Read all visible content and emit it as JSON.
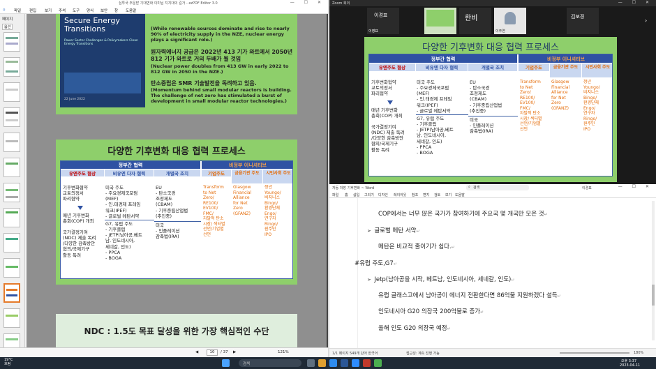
{
  "pdf_window": {
    "title": "심투국 주문받 기대변화 이미님 지지대의 길거 - ezPDF Editor 3.0",
    "menu": [
      "파일",
      "편집",
      "보기",
      "주석",
      "도구",
      "양식",
      "보안",
      "창",
      "도움말"
    ],
    "side_label": "페이지",
    "side_btn": "옵션",
    "page_current": "10",
    "page_total": "/ 37",
    "zoom": "121%",
    "top_slide": {
      "cover_title": "Secure Energy Transitions",
      "cover_sub": "Power Sector Challenges & Policymakers Clean Energy Transitions",
      "cover_date": "22 June 2022",
      "p1": "(While renewable sources dominate and rise to nearly 90% of electricity supply in the NZE, nuclear energy plays a significant role.)",
      "p2_kr": "원자력에너지 공급은 2022년 413 기가 와트에서 2050년 812 기가 와트로 거의 두배가 될 것임",
      "p2_en": "(Nuclear power doubles from 413 GW in early 2022 to 812 GW in 2050 in the NZE.)",
      "p3_kr": "탄소중립은 SMR 기술발전을 독려하고 있음.",
      "p3_en": "(Momentum behind small modular reactors is building. The challenge of net zero has stimulated a burst of development in small modular reactor technologies.)"
    },
    "bottom_slide_title": "NDC : 1.5도 목표 달성을 위한 가장 핵심적인 수단"
  },
  "cooperation_slide": {
    "title": "다양한 기후변화 대응 협력 프로세스",
    "gov_header": "정부간 협력",
    "nongov_header": "비정부 이니셔티브",
    "col_headers": [
      "유엔주도 협상",
      "비유엔 다자 협력",
      "개별국 조치",
      "기업주도",
      "금융기관 주도",
      "시민사회 주도"
    ],
    "col1": "기후변화협약\n교토의정서\n파리협약",
    "col1b": "매년 기후변화\n총회(COP) 개최",
    "col1c": "국가결정기여\n(NDC) 제출 독려\n/다양한 감축방안\n협의/국제기구\n활동 독려",
    "col2": "미국 주도\n- 주요경제국포럼\n  (MEF)\n- 인.태경제 프레임\n  워크(IPEF)\n- 글로벌 메탄서약",
    "col2b": "G7, 유럽 주도\n- 기후클럽\n- JETP(남아공,베트\n  남, 인도네시아,\n  세네갈, 인도)\n- PPCA\n- BOGA",
    "col3": "EU\n- 탄소국경\n  조정제도\n  (CBAM)\n- 기후중립산업법\n  (추진중)",
    "col3b": "미국\n- 인플레이션\n  감축법(IRA)",
    "col4": "Transform\nto Net\nZero/\nRE100/\nEV100/\nFMC/\n자발적 탄소\n시장/ 섹터별\n선언/기업별\n선언",
    "col5": "Glasgow\nFinancial\nAlliance\nfor Net\nZero\n(GFANZ)",
    "col6": "청년\nYoungo/\n비지니스\nBingo/\n환경단체\nEngo/\n연구자\nRingo/\n원주민\nIPO"
  },
  "zoom_window": {
    "title": "Zoom 회의",
    "participants": [
      "이경표",
      "이영표",
      "한비",
      "이주연",
      "김보경"
    ],
    "big_initial": "한비"
  },
  "word_window": {
    "title": "자동 저장  기후변화 ~ Word",
    "search_placeholder": "검색",
    "user": "이경표",
    "tabs": [
      "파일",
      "홈",
      "삽입",
      "그리기",
      "디자인",
      "레이아웃",
      "참조",
      "편지",
      "검토",
      "보기",
      "도움말"
    ],
    "lines": [
      "COP에서는 너무 많은 국가가 참여하기에 주요국 몇 개국만 모은 것",
      "글로벌 메탄 서약",
      "메탄은 비교적 줄이기가 쉽다.",
      "#유럽 주도,G7",
      "Jetp(남아공을 시작, 베트남, 인도네시아, 세네갈, 인도)",
      "유럽 글래스고에서 남아공이 에너지 전환한다면 86억불 지원하겠다 설득",
      "인도네시아 G20 의장국 200억불로 증가",
      "올해 인도 G20 의장국 예정"
    ],
    "status_left": "1/1 페이지   549개 단어   한국어",
    "status_mid": "접근성: 계속 진행 가능",
    "zoom_pct": "180%"
  },
  "taskbar": {
    "weather": "19°C\n흐림",
    "search": "검색",
    "time": "오후 3:37",
    "date": "2023-04-11"
  }
}
